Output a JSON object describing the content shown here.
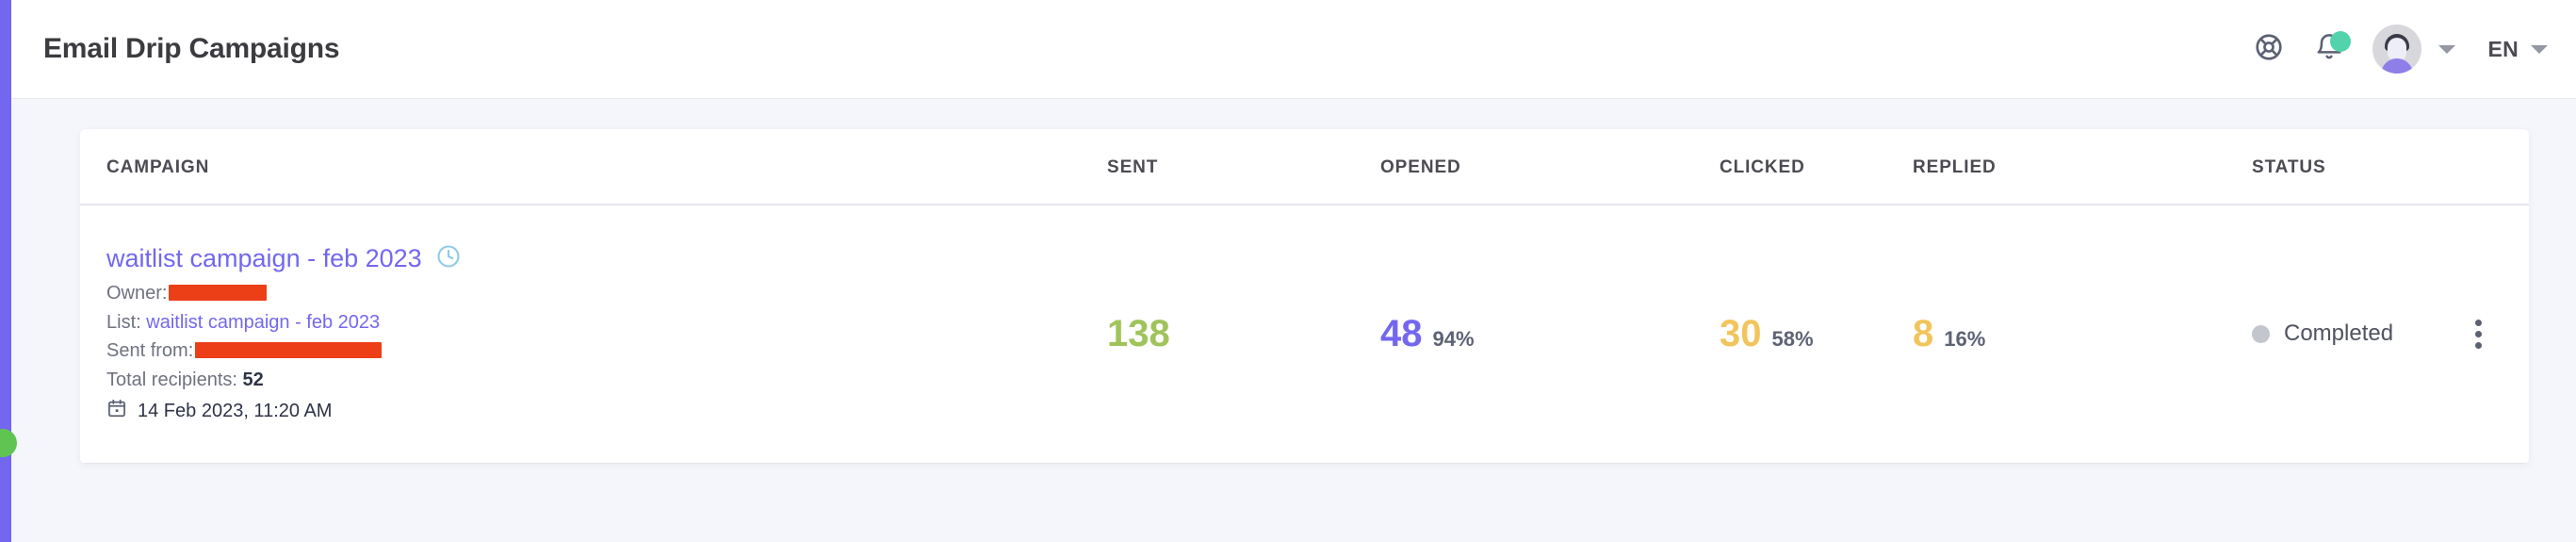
{
  "app": {
    "rail_color": "#7367f0",
    "accent": "#7367f0",
    "background": "#f5f6fb"
  },
  "header": {
    "title": "Email Drip Campaigns",
    "support_icon": "lifebuoy-icon",
    "bell_icon": "bell-icon",
    "notification_dot_color": "#53d3ac",
    "avatar_icon": "user-avatar",
    "language_label": "EN",
    "chevron_icon": "chevron-down-icon"
  },
  "table": {
    "columns": [
      {
        "key": "campaign",
        "label": "CAMPAIGN"
      },
      {
        "key": "sent",
        "label": "SENT"
      },
      {
        "key": "opened",
        "label": "OPENED"
      },
      {
        "key": "clicked",
        "label": "CLICKED"
      },
      {
        "key": "replied",
        "label": "REPLIED"
      },
      {
        "key": "status",
        "label": "STATUS"
      }
    ],
    "rows": [
      {
        "name": "waitlist campaign - feb 2023",
        "schedule_icon": "clock-icon",
        "owner_label": "Owner:",
        "owner_value_redacted": true,
        "list_label": "List:",
        "list_value": "waitlist campaign - feb 2023",
        "sent_from_label": "Sent from:",
        "sent_from_redacted": true,
        "total_recipients_label": "Total recipients:",
        "total_recipients_value": "52",
        "calendar_icon": "calendar-icon",
        "date": "14 Feb 2023, 11:20 AM",
        "sent": "138",
        "opened": "48",
        "opened_pct": "94%",
        "clicked": "30",
        "clicked_pct": "58%",
        "replied": "8",
        "replied_pct": "16%",
        "status": "Completed",
        "status_dot_color": "#c4c6ce",
        "menu_icon": "kebab-menu-icon"
      }
    ]
  }
}
